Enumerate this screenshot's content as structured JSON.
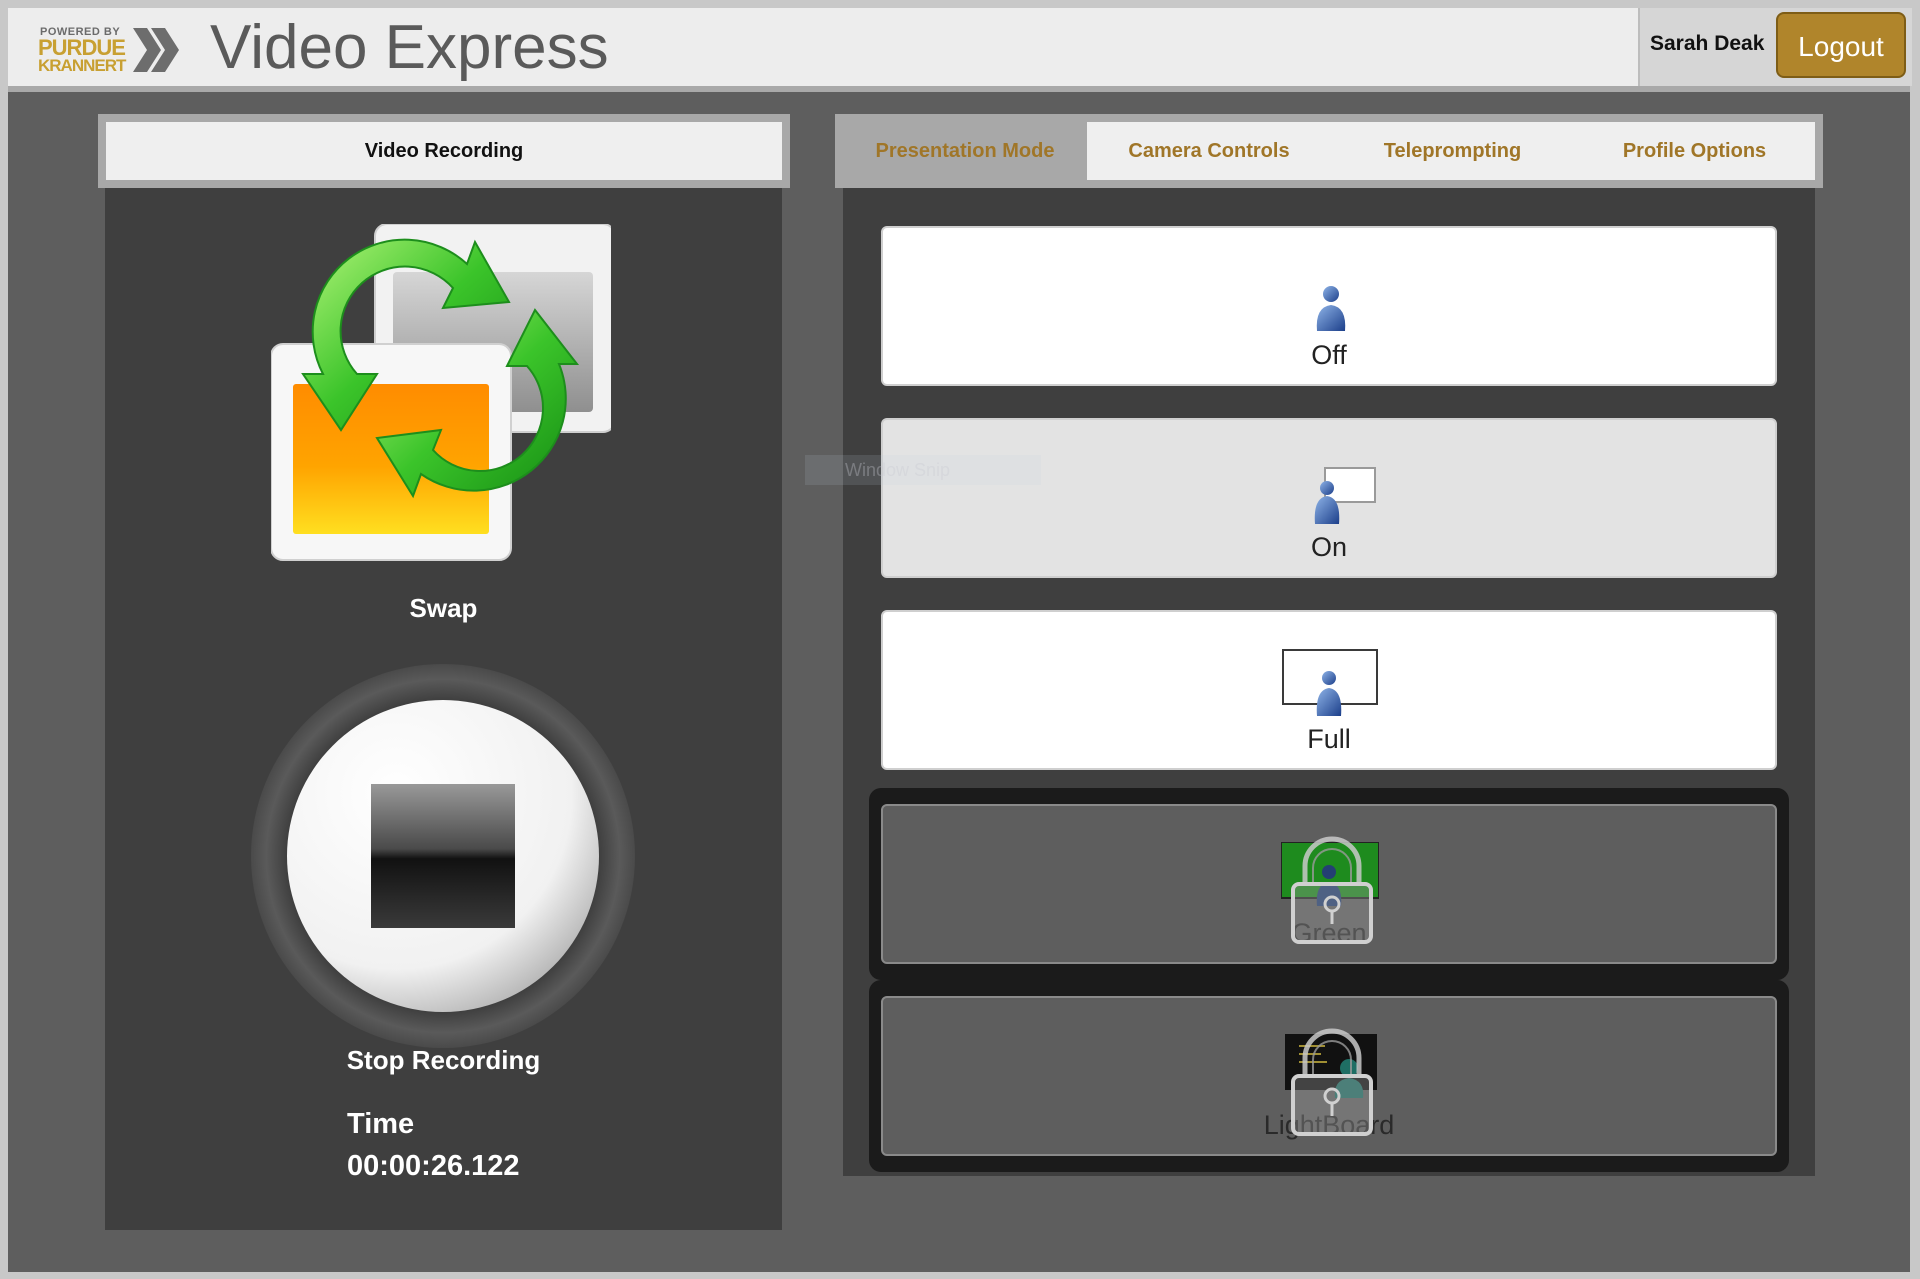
{
  "header": {
    "logo": {
      "powered_by": "POWERED BY",
      "line1": "PURDUE",
      "line2": "KRANNERT"
    },
    "title": "Video Express",
    "user_name": "Sarah Deak",
    "logout_label": "Logout"
  },
  "left": {
    "tab_label": "Video Recording",
    "swap_label": "Swap",
    "stop_label": "Stop Recording",
    "time_label": "Time",
    "time_value": "00:00:26.122"
  },
  "right": {
    "tabs": [
      {
        "label": "Presentation Mode",
        "active": true
      },
      {
        "label": "Camera Controls",
        "active": false
      },
      {
        "label": "Teleprompting",
        "active": false
      },
      {
        "label": "Profile Options",
        "active": false
      }
    ],
    "modes": [
      {
        "label": "Off",
        "locked": false
      },
      {
        "label": "On",
        "locked": false,
        "selected": true
      },
      {
        "label": "Full",
        "locked": false
      },
      {
        "label": "Green",
        "locked": true
      },
      {
        "label": "LightBoard",
        "locked": true
      }
    ]
  },
  "overlay": {
    "snip_text": "Window Snip"
  },
  "colors": {
    "accent": "#b0852b",
    "tab_text": "#a07628",
    "panel_bg": "#3f3f3f",
    "frame_bg": "#5e5e5e"
  }
}
